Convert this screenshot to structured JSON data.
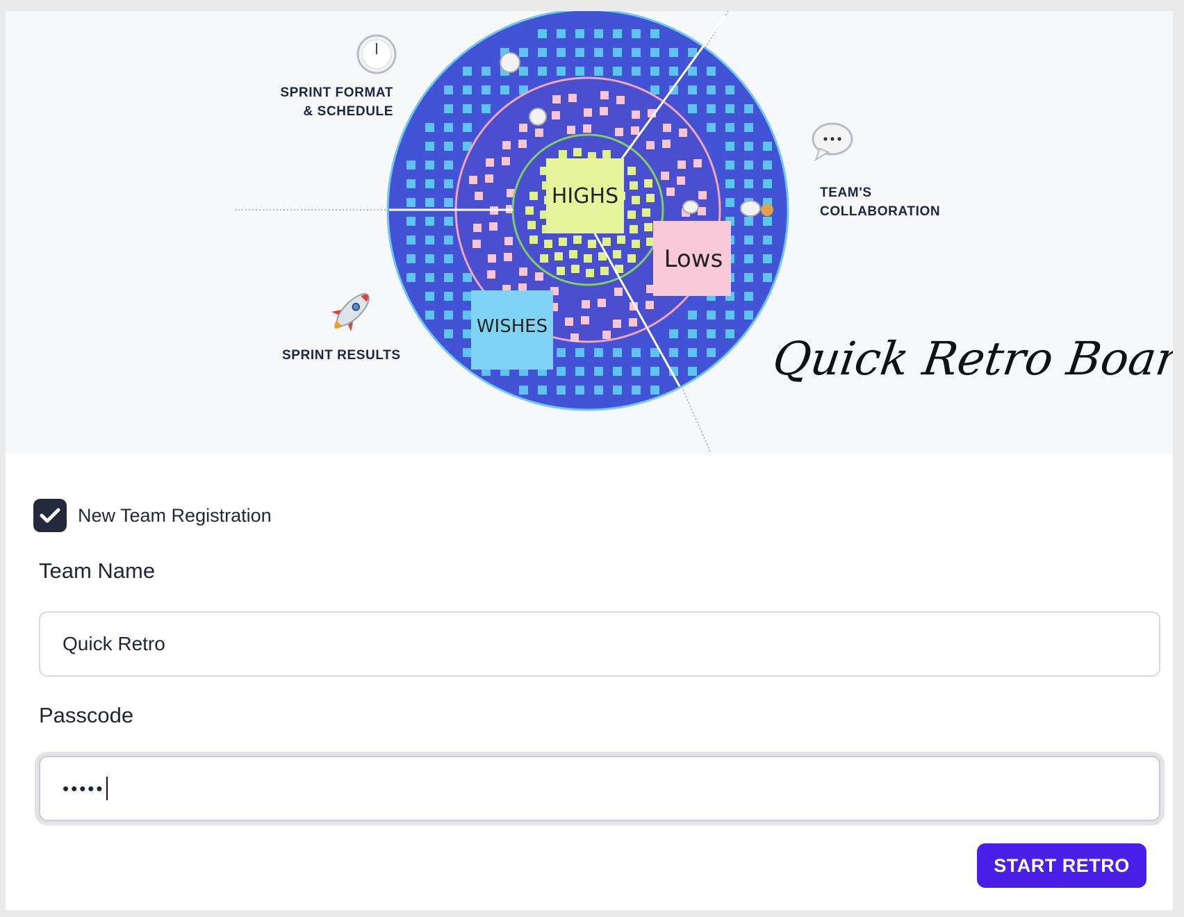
{
  "hero": {
    "label_sprint_format_line1": "SPRINT FORMAT",
    "label_sprint_format_line2": "& SCHEDULE",
    "label_team_line1": "TEAM'S",
    "label_team_line2": "COLLABORATION",
    "label_sprint_results": "SPRINT RESULTS",
    "note_highs": "HIGHS",
    "note_lows": "Lows",
    "note_wishes": "WISHES",
    "title": "Quick Retro Board",
    "icons": [
      "clock-icon",
      "speech-bubble-icon",
      "rocket-icon"
    ],
    "colors": {
      "outer_ring": "#4353d6",
      "blue_note": "#5ec3f2",
      "pink_note": "#f8c6d6",
      "green_note": "#dff28a",
      "highs_note": "#e6f59b",
      "lows_note": "#f8c9d8",
      "wishes_note": "#7fd3f4"
    }
  },
  "form": {
    "checkbox_label": "New Team Registration",
    "checkbox_checked": true,
    "team_name_label": "Team Name",
    "team_name_value": "Quick Retro",
    "passcode_label": "Passcode",
    "passcode_value": "•••••",
    "submit_label": "START RETRO",
    "accent_color": "#4a1fe8"
  }
}
